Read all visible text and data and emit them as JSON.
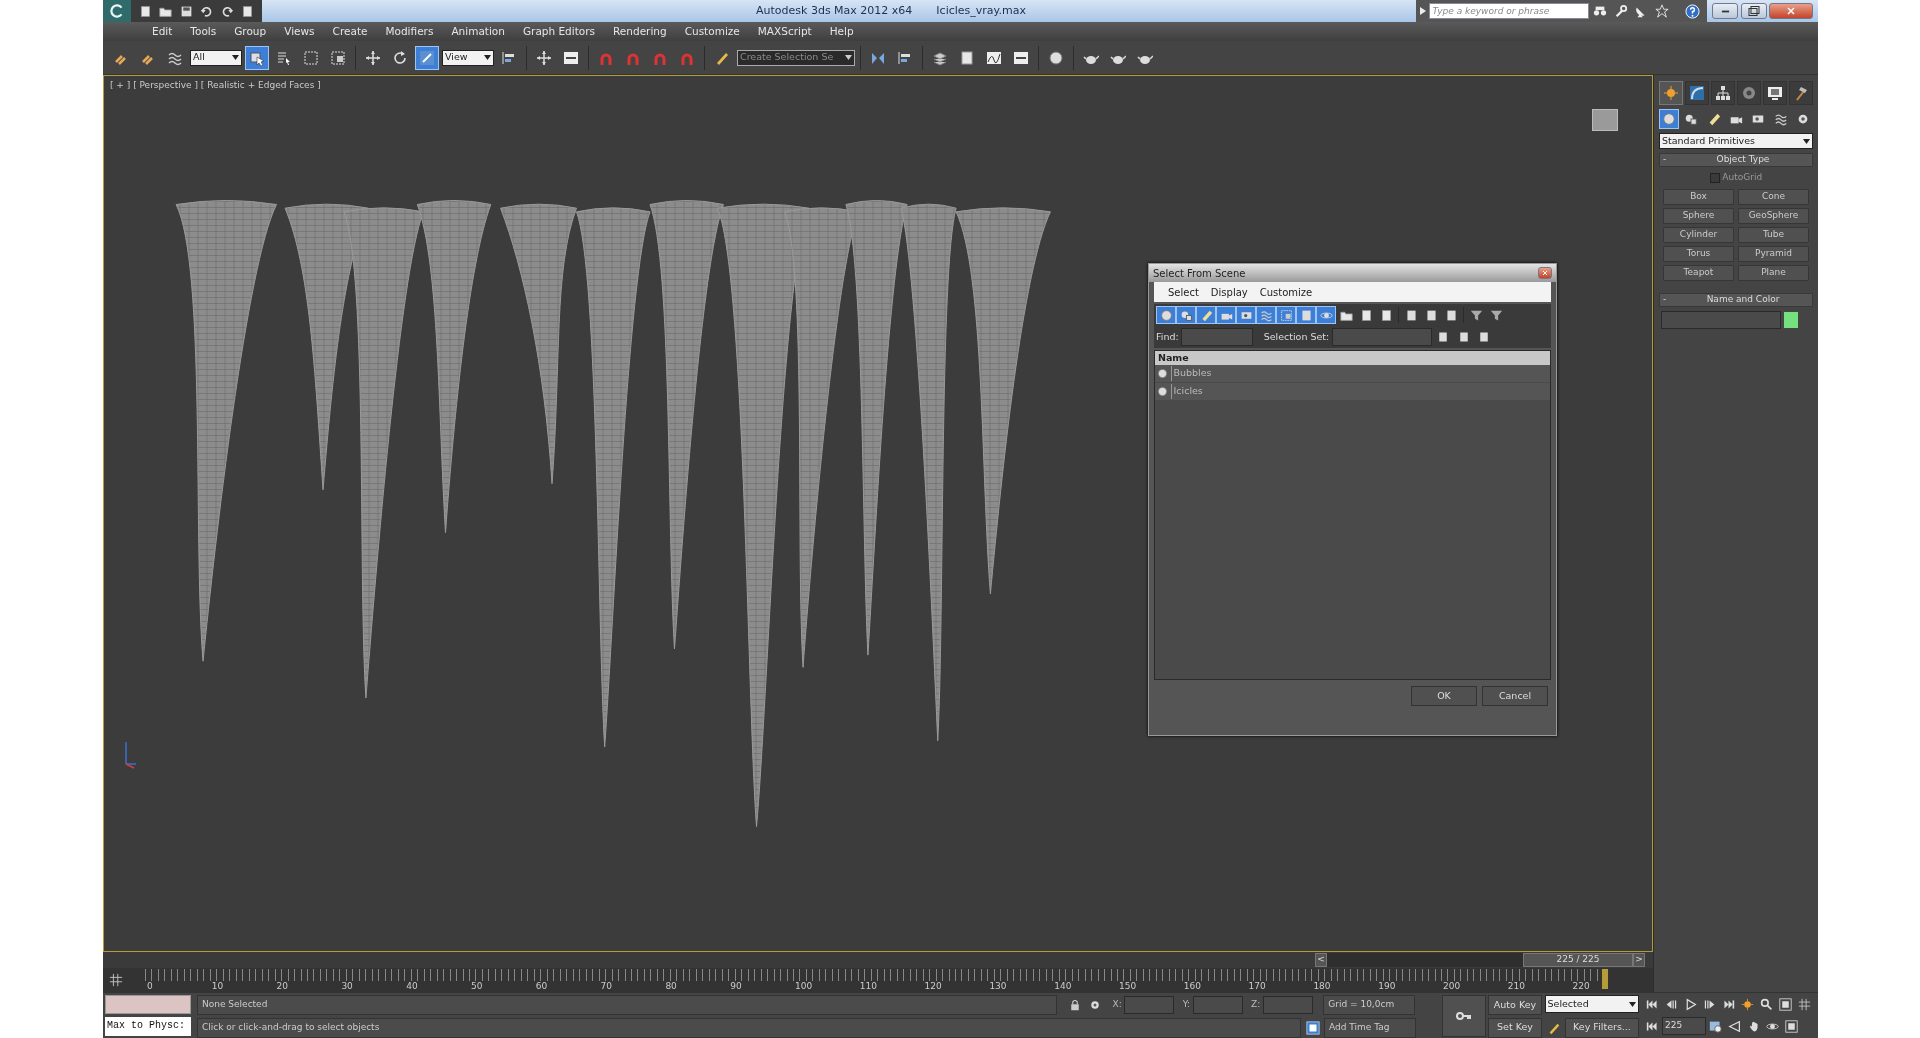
{
  "window": {
    "title": "Autodesk 3ds Max  2012 x64",
    "file": "Icicles_vray.max"
  },
  "search": {
    "placeholder": "Type a keyword or phrase"
  },
  "menu": [
    "Edit",
    "Tools",
    "Group",
    "Views",
    "Create",
    "Modifiers",
    "Animation",
    "Graph Editors",
    "Rendering",
    "Customize",
    "MAXScript",
    "Help"
  ],
  "main_toolbar": {
    "selection_filter": "All",
    "reference_coordinate_system": "View",
    "named_selection_set": "Create Selection Se"
  },
  "viewport": {
    "label": "[ + ] [ Perspective ] [ Realistic + Edged Faces ]"
  },
  "command_panel": {
    "tabs": [
      {
        "selected": true
      },
      {
        "selected": false
      },
      {
        "selected": false
      },
      {
        "selected": false
      },
      {
        "selected": false
      },
      {
        "selected": false
      }
    ],
    "categories": [
      {
        "selected": true
      },
      {
        "selected": false
      },
      {
        "selected": false
      },
      {
        "selected": false
      },
      {
        "selected": false
      },
      {
        "selected": false
      },
      {
        "selected": false
      }
    ],
    "dropdown": "Standard Primitives",
    "object_type": {
      "toggle": "-",
      "title": "Object Type",
      "autogrid": {
        "label": "AutoGrid",
        "checked": false
      },
      "buttons": [
        "Box",
        "Cone",
        "Sphere",
        "GeoSphere",
        "Cylinder",
        "Tube",
        "Torus",
        "Pyramid",
        "Teapot",
        "Plane"
      ]
    },
    "name_and_color": {
      "toggle": "-",
      "title": "Name and Color",
      "color": "#74e07e"
    }
  },
  "dialog": {
    "title": "Select From Scene",
    "menu": [
      "Select",
      "Display",
      "Customize"
    ],
    "filters": [
      {
        "on": true
      },
      {
        "on": true
      },
      {
        "on": true
      },
      {
        "on": true
      },
      {
        "on": true
      },
      {
        "on": true
      },
      {
        "on": true
      },
      {
        "on": true
      },
      {
        "on": true
      }
    ],
    "find_label": "Find:",
    "selection_set_label": "Selection Set:",
    "column": "Name",
    "rows": [
      "Bubbles",
      "Icicles"
    ],
    "buttons": [
      "OK",
      "Cancel"
    ]
  },
  "time_slider": {
    "prev": "<",
    "frame": "225 / 225",
    "next": ">",
    "level": 1
  },
  "ruler": {
    "ticks": [
      "0",
      "10",
      "20",
      "30",
      "40",
      "50",
      "60",
      "70",
      "80",
      "90",
      "100",
      "110",
      "120",
      "130",
      "140",
      "150",
      "160",
      "170",
      "180",
      "190",
      "200",
      "210",
      "220"
    ]
  },
  "status": {
    "listener": "Max to Physc:",
    "selection": "None Selected",
    "prompt": "Click or click-and-drag to select objects",
    "x_label": "X:",
    "y_label": "Y:",
    "z_label": "Z:",
    "grid": "Grid = 10,0cm",
    "add_time_tag": "Add Time Tag"
  },
  "animation": {
    "auto_key": "Auto Key",
    "key_mode": "Selected",
    "set_key": "Set Key",
    "key_filters": "Key Filters...",
    "current_frame": "225"
  }
}
